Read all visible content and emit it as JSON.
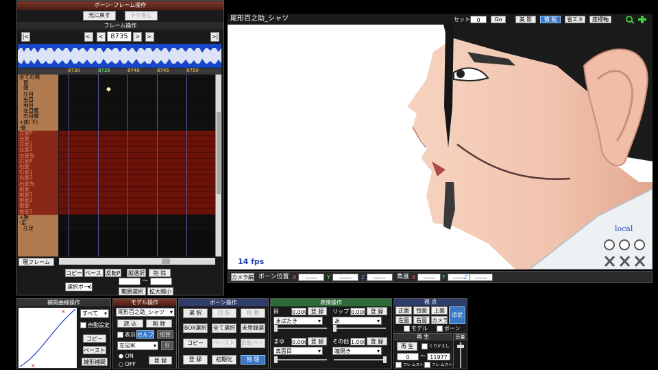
{
  "frame_panel": {
    "title": "ボーン･フレーム操作",
    "undo_label": "元に戻す",
    "redo_label": "やり直し",
    "frame_op_title": "フレーム操作",
    "current_frame": "8735",
    "nav": {
      "first": "|<",
      "prev_key": "<.",
      "prev": "<",
      "next": ">",
      "next_key": ">.",
      "last": ">|"
    },
    "ruler_ticks": [
      "8730",
      "8735",
      "8740",
      "8745",
      "8750"
    ],
    "bones": [
      {
        "label": "全ての親",
        "type": "head"
      },
      {
        "label": "首",
        "type": "bone"
      },
      {
        "label": "頭",
        "type": "bone"
      },
      {
        "label": "左目",
        "type": "bone"
      },
      {
        "label": "右目",
        "type": "bone"
      },
      {
        "label": "両目",
        "type": "bone"
      },
      {
        "label": "左目親",
        "type": "bone"
      },
      {
        "label": "右目親",
        "type": "bone"
      },
      {
        "label": "+体(下)",
        "type": "head"
      },
      {
        "label": "-髪",
        "type": "head"
      },
      {
        "label": "左髪P",
        "type": "sel"
      },
      {
        "label": "左髪",
        "type": "sel"
      },
      {
        "label": "左髪1",
        "type": "sel"
      },
      {
        "label": "左髪2",
        "type": "sel"
      },
      {
        "label": "左髪先",
        "type": "sel"
      },
      {
        "label": "右髪P",
        "type": "sel"
      },
      {
        "label": "右髪",
        "type": "sel"
      },
      {
        "label": "右髪1",
        "type": "sel"
      },
      {
        "label": "右髪2",
        "type": "sel"
      },
      {
        "label": "右髪先",
        "type": "sel"
      },
      {
        "label": "前髪",
        "type": "sel"
      },
      {
        "label": "前髪1",
        "type": "sel"
      },
      {
        "label": "前髪2",
        "type": "sel"
      },
      {
        "label": "後髪",
        "type": "sel"
      },
      {
        "label": "後髪1",
        "type": "sel"
      },
      {
        "label": "+腕",
        "type": "head"
      },
      {
        "label": "-足",
        "type": "head"
      },
      {
        "label": "左足",
        "type": "bone"
      }
    ],
    "current_frame_button": "現フレーム",
    "copy": "コピー",
    "paste": "ペースト",
    "reverse_paste": "反転P",
    "vertical_select": "縦選択",
    "delete": "削 除",
    "select_bone": "選択ボーン",
    "range_tilde": "～",
    "range_select": "範囲選択",
    "scale": "拡大縮小"
  },
  "viewport": {
    "title": "尾形百之助_シャツ",
    "set_label": "セット",
    "set_value": "0",
    "go_label": "Go",
    "shadow": "美 影",
    "info": "情 報",
    "energy": "省エネ",
    "axis": "座標軸",
    "fps": "14 fps",
    "local": "local"
  },
  "camera_bar": {
    "camera_edit": "カメラ編",
    "bone_pos": "ボーン位置",
    "x": "X",
    "y": "Y",
    "z": "Z",
    "pos_x": "------",
    "pos_y": "------",
    "pos_z": "------",
    "angle": "角度",
    "ang_x": "------",
    "ang_y": "------",
    "ang_z": "------"
  },
  "curve_panel": {
    "title": "補間曲線操作",
    "all": "すべて",
    "auto": "自動設定",
    "copy": "コピー",
    "paste": "ペースト",
    "linear": "線形補間"
  },
  "model_panel": {
    "title": "モデル操作",
    "model": "尾形百之助_シャツ",
    "load": "読 込",
    "delete": "削 除",
    "display": "表示",
    "self_shadow": "セルフ影",
    "add": "加算",
    "bone_select": "左足IK",
    "out": "外",
    "on": "ON",
    "off": "OFF",
    "register": "登 録"
  },
  "bone_panel": {
    "title": "ボーン操作",
    "select": "選 択",
    "rotate": "回 転",
    "move": "移 動",
    "box_select": "BOX選択",
    "select_all": "全て選択",
    "unregistered": "未登録選",
    "copy": "コピー",
    "paste": "ペースト",
    "reverse_paste": "反転ペースト",
    "register": "登 録",
    "initialize": "初期化",
    "physics": "物 理"
  },
  "face_panel": {
    "title": "表情操作",
    "eye_label": "目",
    "eye_value": "0.000",
    "eye_reg": "登 録",
    "eye_select": "まばたき",
    "lip_label": "リップ",
    "lip_value": "0.000",
    "lip_reg": "登 録",
    "lip_select": "あ",
    "brow_label": "まゆ",
    "brow_value": "0.000",
    "brow_reg": "登 録",
    "brow_select": "真面目",
    "other_label": "その他",
    "other_value": "1.000",
    "other_reg": "登 録",
    "other_select": "瞳閉き"
  },
  "view_panel": {
    "title": "視 点",
    "front": "正面",
    "back": "背面",
    "top": "上面",
    "follow": "追従",
    "left": "左面",
    "right": "右面",
    "camera": "カメラ",
    "model": "モデル",
    "bone": "ボーン"
  },
  "play_panel": {
    "title": "再 生",
    "play": "再 生",
    "repeat": "くりかえし",
    "from": "0",
    "tilde": "～",
    "to": "11977",
    "frame_stop": "フレ-ムスト-ト",
    "frame_stop2": "フレ-ムストップ"
  },
  "volume_panel": {
    "title": "音量"
  }
}
